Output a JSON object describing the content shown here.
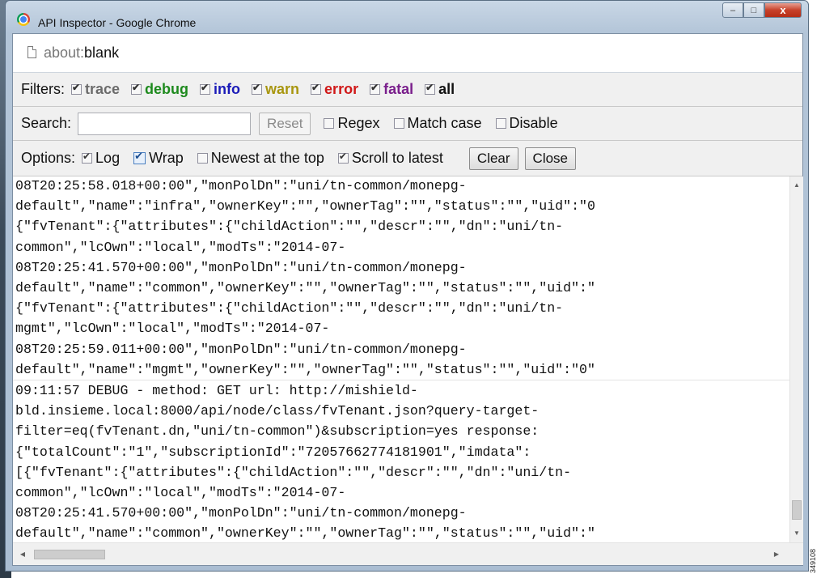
{
  "window": {
    "title": "API Inspector - Google Chrome",
    "minimize": "–",
    "maximize": "□",
    "close": "x"
  },
  "address": {
    "prefix": "about:",
    "page": "blank"
  },
  "filters": {
    "label": "Filters:",
    "items": [
      {
        "label": "trace",
        "checked": true,
        "color": "#6b6b6b"
      },
      {
        "label": "debug",
        "checked": true,
        "color": "#1e8a1e"
      },
      {
        "label": "info",
        "checked": true,
        "color": "#1a1ab8"
      },
      {
        "label": "warn",
        "checked": true,
        "color": "#a8960f"
      },
      {
        "label": "error",
        "checked": true,
        "color": "#d01818"
      },
      {
        "label": "fatal",
        "checked": true,
        "color": "#7a1f8c"
      },
      {
        "label": "all",
        "checked": true,
        "color": "#111111"
      }
    ]
  },
  "search": {
    "label": "Search:",
    "value": "",
    "reset_label": "Reset",
    "regex_label": "Regex",
    "match_case_label": "Match case",
    "disable_label": "Disable"
  },
  "options": {
    "label": "Options:",
    "log_label": "Log",
    "wrap_label": "Wrap",
    "newest_label": "Newest at the top",
    "scroll_label": "Scroll to latest",
    "clear_label": "Clear",
    "close_label": "Close"
  },
  "log": {
    "entries": [
      "08T20:25:58.018+00:00\",\"monPolDn\":\"uni/tn-common/monepg-\ndefault\",\"name\":\"infra\",\"ownerKey\":\"\",\"ownerTag\":\"\",\"status\":\"\",\"uid\":\"0\n{\"fvTenant\":{\"attributes\":{\"childAction\":\"\",\"descr\":\"\",\"dn\":\"uni/tn-\ncommon\",\"lcOwn\":\"local\",\"modTs\":\"2014-07-\n08T20:25:41.570+00:00\",\"monPolDn\":\"uni/tn-common/monepg-\ndefault\",\"name\":\"common\",\"ownerKey\":\"\",\"ownerTag\":\"\",\"status\":\"\",\"uid\":\"\n{\"fvTenant\":{\"attributes\":{\"childAction\":\"\",\"descr\":\"\",\"dn\":\"uni/tn-\nmgmt\",\"lcOwn\":\"local\",\"modTs\":\"2014-07-\n08T20:25:59.011+00:00\",\"monPolDn\":\"uni/tn-common/monepg-\ndefault\",\"name\":\"mgmt\",\"ownerKey\":\"\",\"ownerTag\":\"\",\"status\":\"\",\"uid\":\"0\"",
      "09:11:57 DEBUG - method: GET url: http://mishield-\nbld.insieme.local:8000/api/node/class/fvTenant.json?query-target-\nfilter=eq(fvTenant.dn,\"uni/tn-common\")&subscription=yes response:\n{\"totalCount\":\"1\",\"subscriptionId\":\"72057662774181901\",\"imdata\":\n[{\"fvTenant\":{\"attributes\":{\"childAction\":\"\",\"descr\":\"\",\"dn\":\"uni/tn-\ncommon\",\"lcOwn\":\"local\",\"modTs\":\"2014-07-\n08T20:25:41.570+00:00\",\"monPolDn\":\"uni/tn-common/monepg-\ndefault\",\"name\":\"common\",\"ownerKey\":\"\",\"ownerTag\":\"\",\"status\":\"\",\"uid\":\""
    ]
  },
  "figure_id": "349108"
}
